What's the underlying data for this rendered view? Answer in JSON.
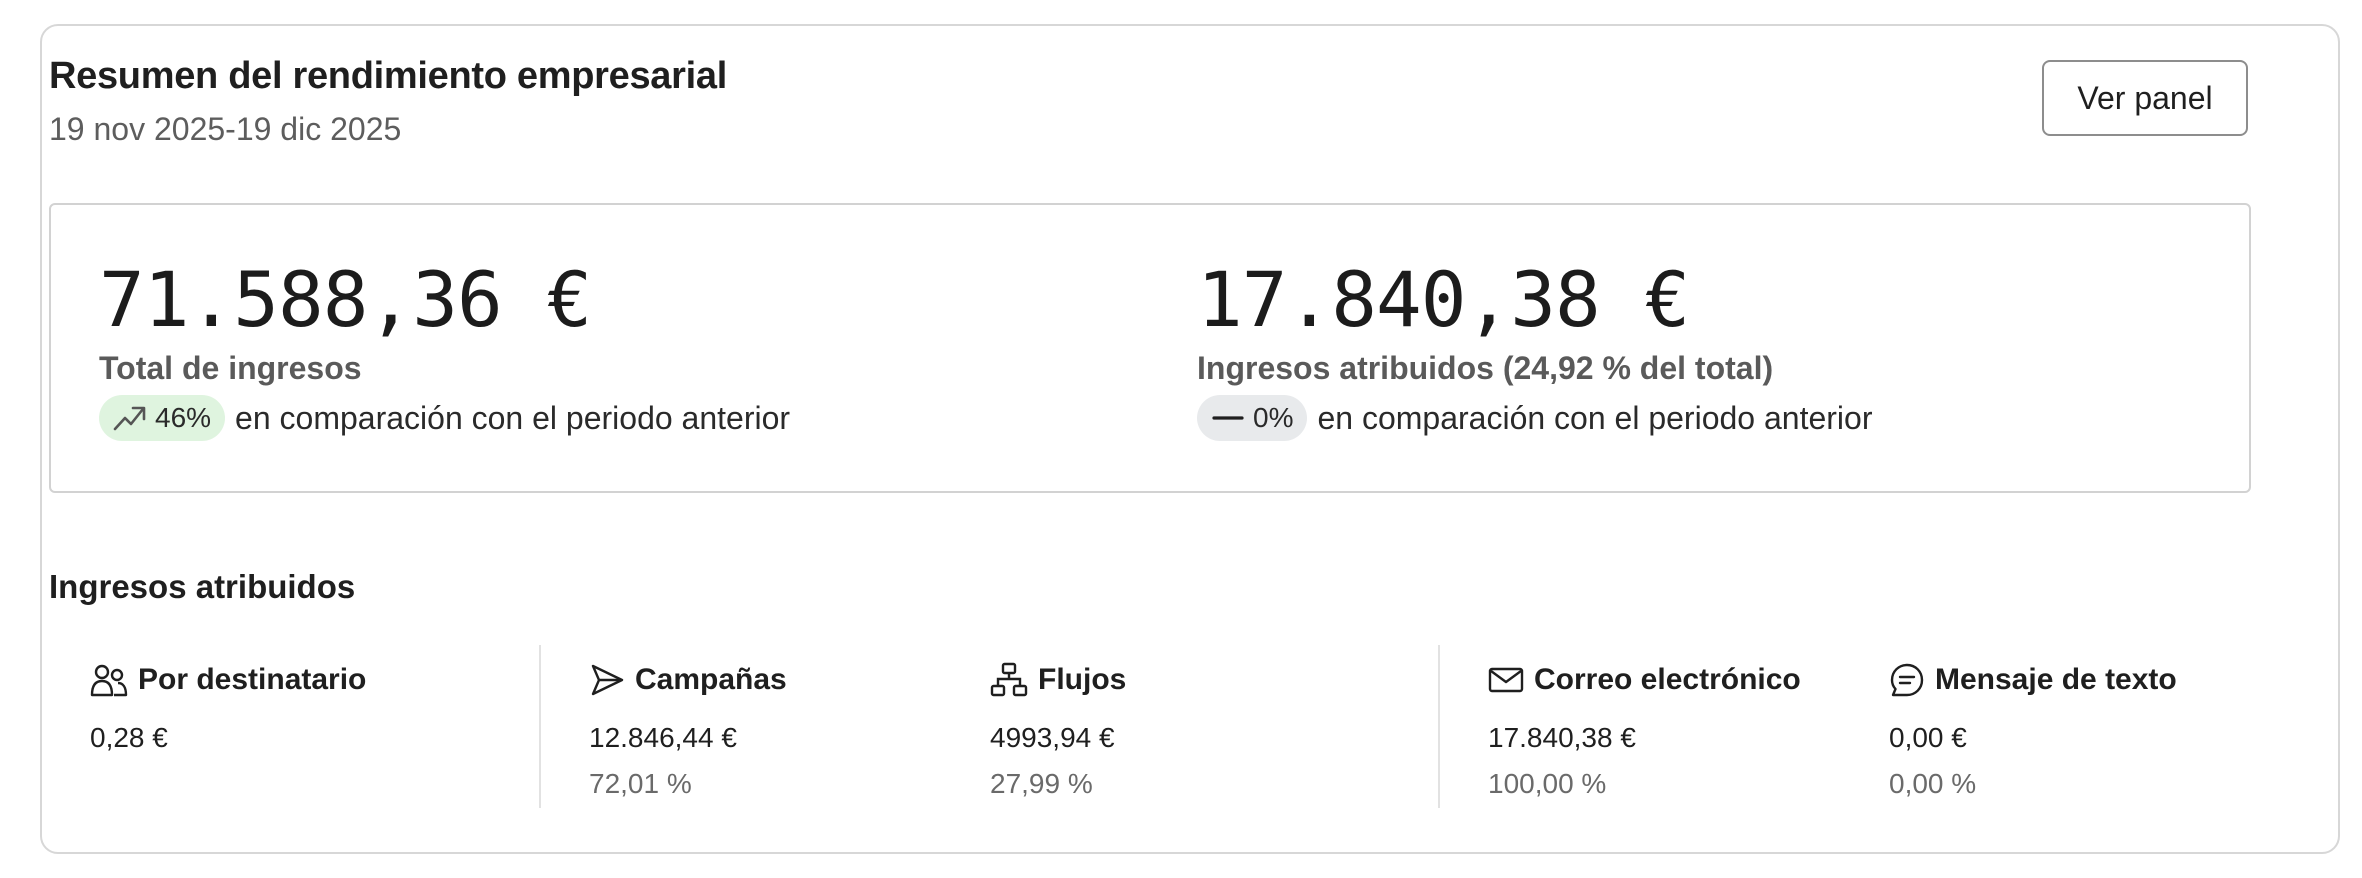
{
  "header": {
    "title": "Resumen del rendimiento empresarial",
    "date_range": "19 nov 2025-19 dic 2025",
    "view_button_label": "Ver panel"
  },
  "metrics": {
    "total": {
      "value": "71.588,36 €",
      "label": "Total de ingresos",
      "change": "46%",
      "change_icon": "trend-up-icon",
      "compare_text": "en comparación con el periodo anterior"
    },
    "attributed": {
      "value": "17.840,38 €",
      "label": "Ingresos atribuidos (24,92 % del total)",
      "change": "0%",
      "change_icon": "dash-icon",
      "compare_text": "en comparación con el periodo anterior"
    }
  },
  "attributed_section": {
    "title": "Ingresos atribuidos",
    "columns": [
      {
        "icon": "people-icon",
        "label": "Por destinatario",
        "value": "0,28 €",
        "percent": ""
      },
      {
        "icon": "send-icon",
        "label": "Campañas",
        "value": "12.846,44 €",
        "percent": "72,01 %"
      },
      {
        "icon": "flow-icon",
        "label": "Flujos",
        "value": "4993,94 €",
        "percent": "27,99 %"
      },
      {
        "icon": "mail-icon",
        "label": "Correo electrónico",
        "value": "17.840,38 €",
        "percent": "100,00 %"
      },
      {
        "icon": "message-icon",
        "label": "Mensaje de texto",
        "value": "0,00 €",
        "percent": "0,00 %"
      }
    ]
  },
  "colors": {
    "badge_up_bg": "#dff4df",
    "badge_flat_bg": "#e8eaec",
    "border": "#d7d7d7"
  }
}
